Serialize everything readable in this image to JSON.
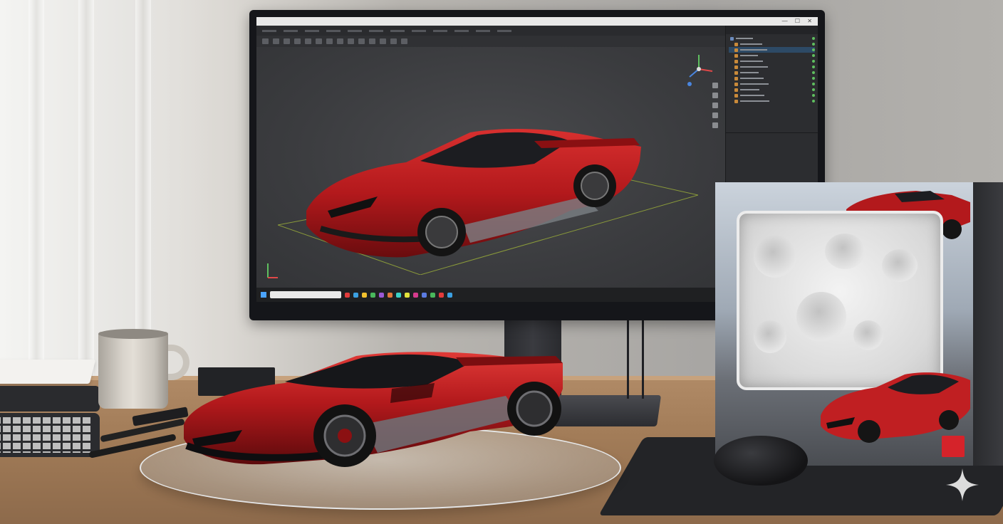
{
  "scene": {
    "description_free": true
  },
  "monitor": {
    "app": {
      "window_controls": "— ☐ ✕",
      "menu_items": [
        "",
        "",
        "",
        "",
        "",
        "",
        "",
        "",
        "",
        "",
        "",
        ""
      ],
      "outliner_rows": [
        {
          "label": "",
          "type": "cam",
          "selected": false
        },
        {
          "label": "",
          "type": "obj",
          "selected": false
        },
        {
          "label": "",
          "type": "obj",
          "selected": true
        },
        {
          "label": "",
          "type": "obj",
          "selected": false
        },
        {
          "label": "",
          "type": "obj",
          "selected": false
        },
        {
          "label": "",
          "type": "obj",
          "selected": false
        },
        {
          "label": "",
          "type": "obj",
          "selected": false
        },
        {
          "label": "",
          "type": "obj",
          "selected": false
        },
        {
          "label": "",
          "type": "obj",
          "selected": false
        },
        {
          "label": "",
          "type": "obj",
          "selected": false
        },
        {
          "label": "",
          "type": "obj",
          "selected": false
        },
        {
          "label": "",
          "type": "obj",
          "selected": false
        }
      ]
    },
    "taskbar": {
      "taskbar_colors": [
        "#e23b3b",
        "#3ba0e2",
        "#f2c12e",
        "#49b85c",
        "#9b59d6",
        "#e2763b",
        "#3bd0c6",
        "#e2e23b",
        "#d63b8e",
        "#5b7be2",
        "#49b85c",
        "#e23b3b",
        "#3ba0e2"
      ]
    }
  },
  "colors": {
    "car_red": "#b3191c",
    "car_dark": "#6a0c0e",
    "ui_bg": "#3a3b3e",
    "badge_red": "#d5232a"
  },
  "icons": [
    "gizmo-axis",
    "sparkle-icon"
  ]
}
